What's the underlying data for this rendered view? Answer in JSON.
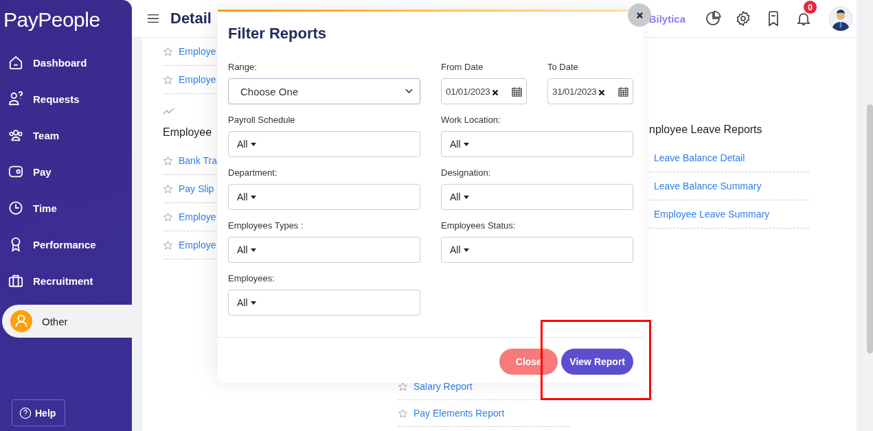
{
  "sidebar": {
    "logo": "PayPeople",
    "items": [
      {
        "label": "Dashboard",
        "selected": false
      },
      {
        "label": "Requests",
        "selected": false
      },
      {
        "label": "Team",
        "selected": false
      },
      {
        "label": "Pay",
        "selected": false
      },
      {
        "label": "Time",
        "selected": false
      },
      {
        "label": "Performance",
        "selected": false
      },
      {
        "label": "Recruitment",
        "selected": false
      },
      {
        "label": "Other",
        "selected": true
      }
    ],
    "help": "Help"
  },
  "header": {
    "title": "Detail",
    "company": "Bilytica",
    "notification_count": "0"
  },
  "report_columns": [
    {
      "sections": [
        {
          "links": [
            "Employe",
            "Employe"
          ]
        },
        {
          "heading": "Employee",
          "links": [
            "Bank Tra",
            "Pay Slip",
            "Employe",
            "Employe"
          ]
        }
      ]
    },
    {
      "sections": [
        {
          "links": [
            "Salary Report",
            "Pay Elements Report"
          ]
        }
      ]
    },
    {
      "sections": [
        {
          "heading": "nployee Leave Reports",
          "links": [
            "Leave Balance Detail",
            "Leave Balance Summary",
            "Employee Leave Summary"
          ]
        }
      ]
    }
  ],
  "filter_modal": {
    "title": "Filter Reports",
    "fields": [
      {
        "kind": "select",
        "label": "Range:",
        "value": "Choose One"
      },
      {
        "kind": "date",
        "label": "From Date",
        "value": "01/01/2023"
      },
      {
        "kind": "date",
        "label": "To Date",
        "value": "31/01/2023"
      },
      {
        "kind": "dropdown",
        "label": "Payroll Schedule",
        "value": "All"
      },
      {
        "kind": "dropdown",
        "label": "Work Location:",
        "value": "All"
      },
      {
        "kind": "dropdown",
        "label": "Department:",
        "value": "All"
      },
      {
        "kind": "dropdown",
        "label": "Designation:",
        "value": "All"
      },
      {
        "kind": "dropdown",
        "label": "Employees Types :",
        "value": "All"
      },
      {
        "kind": "dropdown",
        "label": "Employees Status:",
        "value": "All"
      },
      {
        "kind": "dropdown",
        "label": "Employees:",
        "value": "All"
      }
    ],
    "buttons": [
      {
        "label": "Close",
        "kind": "secondary"
      },
      {
        "label": "View Report",
        "kind": "primary"
      }
    ]
  }
}
